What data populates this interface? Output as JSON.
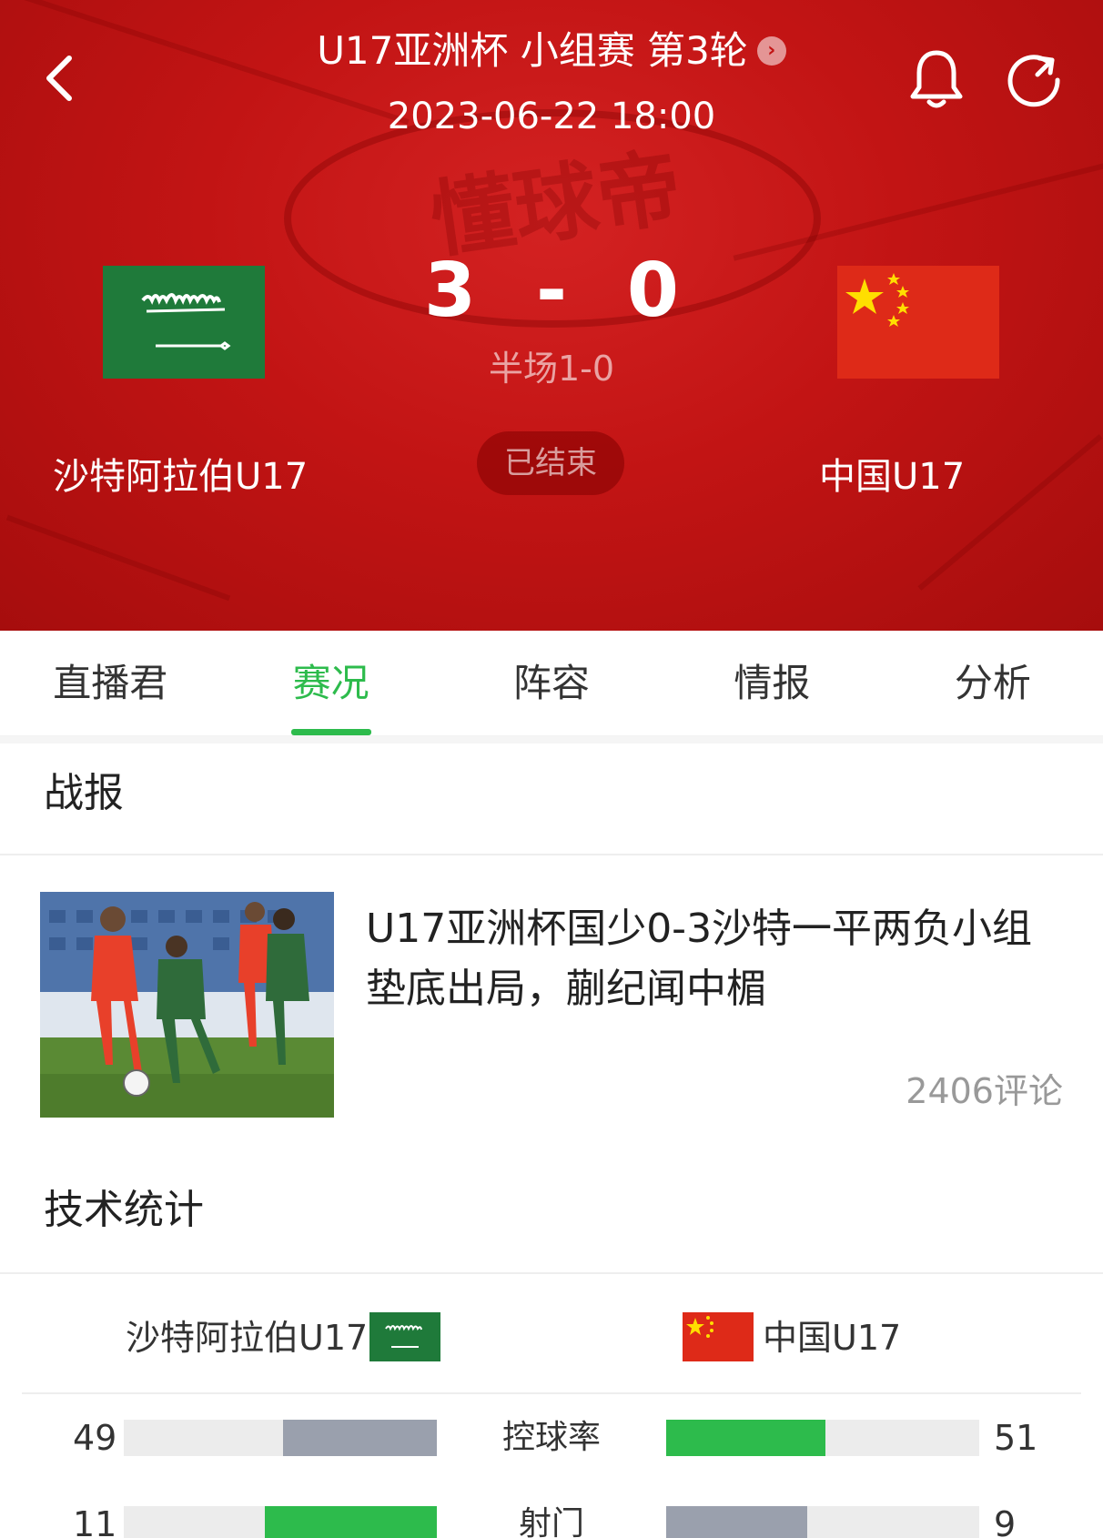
{
  "header": {
    "match_title": "U17亚洲杯 小组赛 第3轮",
    "datetime": "2023-06-22 18:00",
    "home_team": "沙特阿拉伯U17",
    "away_team": "中国U17",
    "home_score": "3",
    "score_separator": "-",
    "away_score": "0",
    "halftime": "半场1-0",
    "status": "已结束",
    "watermark": "懂球帝",
    "colors": {
      "background": "#c21414",
      "accent": "#ffffff"
    }
  },
  "tabs": [
    {
      "label": "直播君",
      "active": false
    },
    {
      "label": "赛况",
      "active": true
    },
    {
      "label": "阵容",
      "active": false
    },
    {
      "label": "情报",
      "active": false
    },
    {
      "label": "分析",
      "active": false
    }
  ],
  "report": {
    "section_title": "战报",
    "news_title": "U17亚洲杯国少0-3沙特一平两负小组垫底出局，蒯纪闻中楣",
    "comments": "2406评论"
  },
  "stats": {
    "section_title": "技术统计",
    "home_team": "沙特阿拉伯U17",
    "away_team": "中国U17",
    "rows": [
      {
        "label": "控球率",
        "home": "49",
        "away": "51",
        "home_fraction": 0.49,
        "away_fraction": 0.51,
        "leader": "away"
      },
      {
        "label": "射门",
        "home": "11",
        "away": "9",
        "home_fraction": 0.55,
        "away_fraction": 0.45,
        "leader": "home"
      }
    ],
    "colors": {
      "leader_bar": "#2dbb4c",
      "trailer_bar": "#9aa0ad",
      "track": "#ececec"
    }
  },
  "icons": [
    "back-arrow-icon",
    "bell-icon",
    "refresh-icon",
    "chevron-right-icon"
  ]
}
